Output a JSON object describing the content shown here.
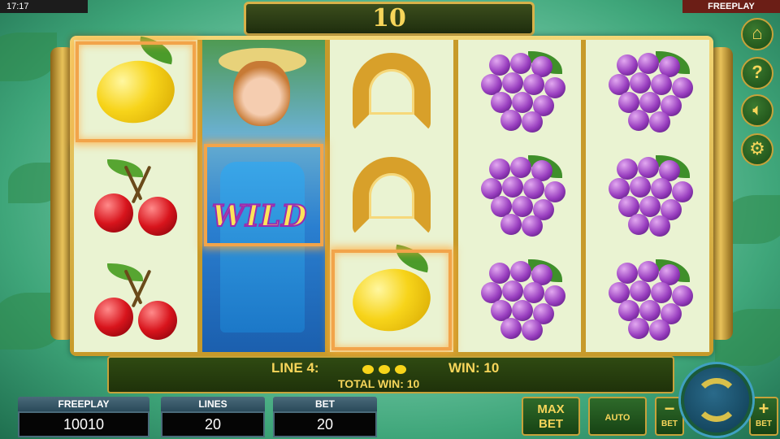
{
  "status": {
    "time": "17:17",
    "mode": "FREEPLAY"
  },
  "win_banner": {
    "value": "10"
  },
  "reels": [
    [
      "lemon",
      "cherries",
      "cherries"
    ],
    [
      "wild",
      "wild",
      "wild"
    ],
    [
      "horseshoe",
      "horseshoe",
      "lemon"
    ],
    [
      "grapes",
      "grapes",
      "grapes"
    ],
    [
      "grapes",
      "grapes",
      "grapes"
    ]
  ],
  "wild_label": "WILD",
  "win_info": {
    "line_label": "LINE 4:",
    "line_symbols": [
      "lemon",
      "lemon",
      "lemon"
    ],
    "win_label": "WIN: 10",
    "total_label": "TOTAL WIN: 10"
  },
  "stats": {
    "freeplay": {
      "label": "FREEPLAY",
      "value": "10010"
    },
    "lines": {
      "label": "LINES",
      "value": "20"
    },
    "bet": {
      "label": "BET",
      "value": "20"
    }
  },
  "buttons": {
    "max": "MAX",
    "bet": "BET",
    "auto": "AUTO",
    "bet_minus": "BET",
    "bet_plus": "BET",
    "minus": "−",
    "plus": "+"
  },
  "side_icons": [
    "home-icon",
    "help-icon",
    "sound-mute-icon",
    "settings-icon"
  ],
  "colors": {
    "gold": "#f6d55a",
    "frame": "#c79a2a",
    "win_highlight": "#f2a44a"
  }
}
